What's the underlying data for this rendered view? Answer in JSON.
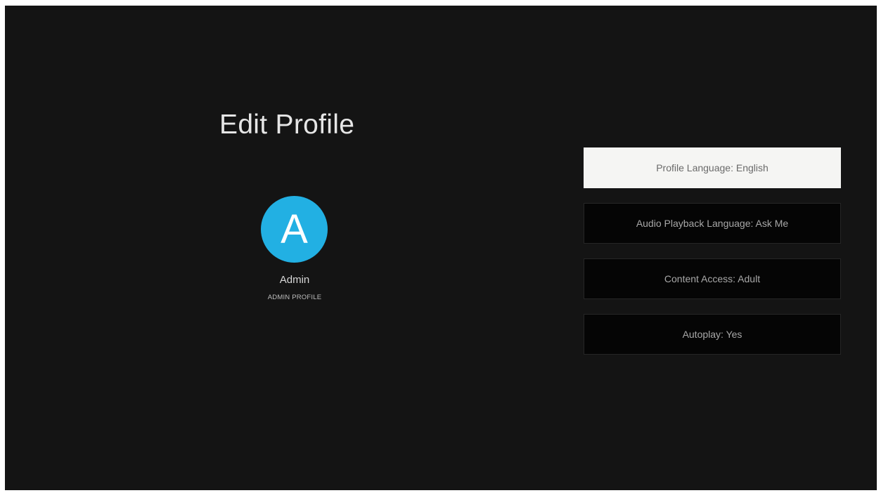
{
  "header": {
    "title": "Edit Profile"
  },
  "profile": {
    "avatar_letter": "A",
    "avatar_color": "#22b0e3",
    "name": "Admin",
    "role": "ADMIN PROFILE"
  },
  "settings": {
    "selected_index": 0,
    "items": [
      {
        "label": "Profile Language: English"
      },
      {
        "label": "Audio Playback Language: Ask Me"
      },
      {
        "label": "Content Access: Adult"
      },
      {
        "label": "Autoplay: Yes"
      }
    ]
  },
  "colors": {
    "background": "#141414",
    "selected_item_background": "#f5f5f3",
    "item_background": "#050505"
  }
}
